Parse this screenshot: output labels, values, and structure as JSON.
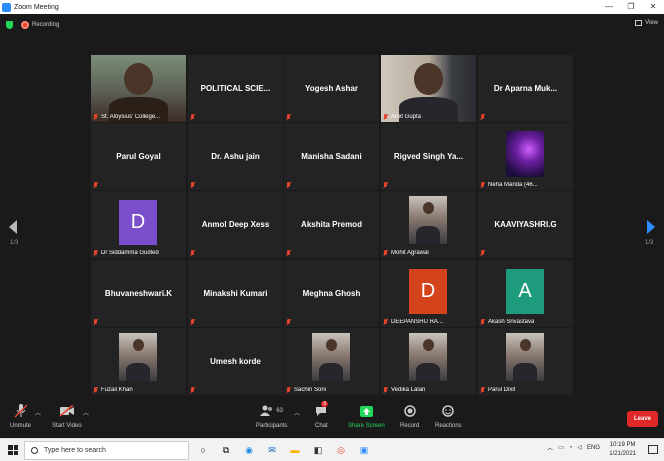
{
  "window": {
    "title": "Zoom Meeting",
    "minimize": "—",
    "maximize": "❐",
    "close": "✕"
  },
  "topbar": {
    "recording_label": "Recording",
    "view_label": "View"
  },
  "pager": {
    "left_page": "1/3",
    "right_page": "1/3"
  },
  "tiles": [
    {
      "label": "St. Aloysius' College...",
      "type": "video",
      "active": true
    },
    {
      "name": "POLITICAL  SCIE..."
    },
    {
      "name": "Yogesh Ashar"
    },
    {
      "label": "Amit Gupta",
      "type": "video"
    },
    {
      "name": "Dr Aparna Muk..."
    },
    {
      "name": "Parul Goyal"
    },
    {
      "name": "Dr. Ashu jain"
    },
    {
      "name": "Manisha Sadani"
    },
    {
      "name": "Rigved  Singh  Ya..."
    },
    {
      "label": "Neha Manda (46...",
      "type": "video"
    },
    {
      "label": "Dr Siddamma Gudled",
      "type": "avatar",
      "letter": "D",
      "color": "#7b4fcc"
    },
    {
      "name": "Anmol Deep Xess"
    },
    {
      "name": "Akshita Premod"
    },
    {
      "label": "Mohit Agrawal",
      "type": "photo"
    },
    {
      "name": "KAAVIYASHRI.G"
    },
    {
      "name": "Bhuvaneshwari.K"
    },
    {
      "name": "Minakshi Kumari"
    },
    {
      "name": "Meghna Ghosh"
    },
    {
      "label": "DEEPANSHU RA...",
      "type": "avatar",
      "letter": "D",
      "color": "#d4441c"
    },
    {
      "label": "Akash Srivastava",
      "type": "avatar",
      "letter": "A",
      "color": "#1e9a7c"
    },
    {
      "label": "Fuzail Khan",
      "type": "photo"
    },
    {
      "name": "Umesh korde"
    },
    {
      "label": "Sachin Soni",
      "type": "photo"
    },
    {
      "label": "Vedika Lalan",
      "type": "photo"
    },
    {
      "label": "Parul Dixit",
      "type": "photo"
    }
  ],
  "toolbar": {
    "unmute": "Unmute",
    "start_video": "Start Video",
    "participants": "Participants",
    "participants_count": "63",
    "chat": "Chat",
    "chat_badge": "8",
    "share_screen": "Share Screen",
    "record": "Record",
    "reactions": "Reactions",
    "leave": "Leave"
  },
  "taskbar": {
    "search_placeholder": "Type here to search",
    "lang": "ENG",
    "time": "10:19 PM",
    "date": "1/21/2021"
  },
  "colors": {
    "accent": "#2d8cff",
    "active_speaker": "#b9e057",
    "share": "#23d959",
    "leave": "#e02828"
  }
}
